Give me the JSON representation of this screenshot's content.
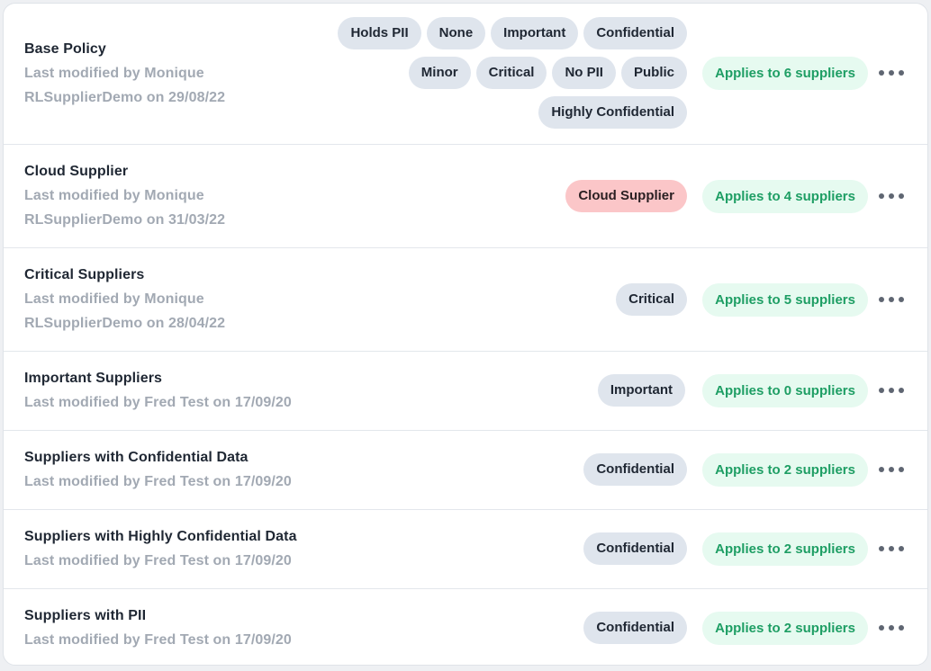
{
  "policies": [
    {
      "title": "Base Policy",
      "meta": [
        "Last modified by Monique",
        "RLSupplierDemo on 29/08/22"
      ],
      "tags": [
        [
          "Holds PII",
          "None",
          "Important",
          "Confidential"
        ],
        [
          "Minor",
          "Critical",
          "No PII",
          "Public"
        ],
        [
          "Highly Confidential"
        ]
      ],
      "applies": "Applies to 6 suppliers"
    },
    {
      "title": "Cloud Supplier",
      "meta": [
        "Last modified by Monique",
        "RLSupplierDemo on 31/03/22"
      ],
      "tags": [
        [
          "Cloud Supplier"
        ]
      ],
      "tag_color": "#fbc6c8",
      "applies": "Applies to 4 suppliers"
    },
    {
      "title": "Critical Suppliers",
      "meta": [
        "Last modified by Monique",
        "RLSupplierDemo on 28/04/22"
      ],
      "tags": [
        [
          "Critical"
        ]
      ],
      "applies": "Applies to 5 suppliers"
    },
    {
      "title": "Important Suppliers",
      "meta": [
        "Last modified by Fred Test on 17/09/20"
      ],
      "tags": [
        [
          "Important"
        ]
      ],
      "applies": "Applies to 0 suppliers"
    },
    {
      "title": "Suppliers with Confidential Data",
      "meta": [
        "Last modified by Fred Test on 17/09/20"
      ],
      "tags": [
        [
          "Confidential"
        ]
      ],
      "applies": "Applies to 2 suppliers"
    },
    {
      "title": "Suppliers with Highly Confidential Data",
      "meta": [
        "Last modified by Fred Test on 17/09/20"
      ],
      "tags": [
        [
          "Confidential"
        ]
      ],
      "applies": "Applies to 2 suppliers"
    },
    {
      "title": "Suppliers with PII",
      "meta": [
        "Last modified by Fred Test on 17/09/20"
      ],
      "tags": [
        [
          "Confidential"
        ]
      ],
      "applies": "Applies to 2 suppliers"
    }
  ],
  "colors": {
    "tag_default": "#dfe5ed",
    "applies_bg": "#e6faf0",
    "applies_text": "#1e9e64"
  },
  "icons": {
    "more": "more-options-icon"
  }
}
